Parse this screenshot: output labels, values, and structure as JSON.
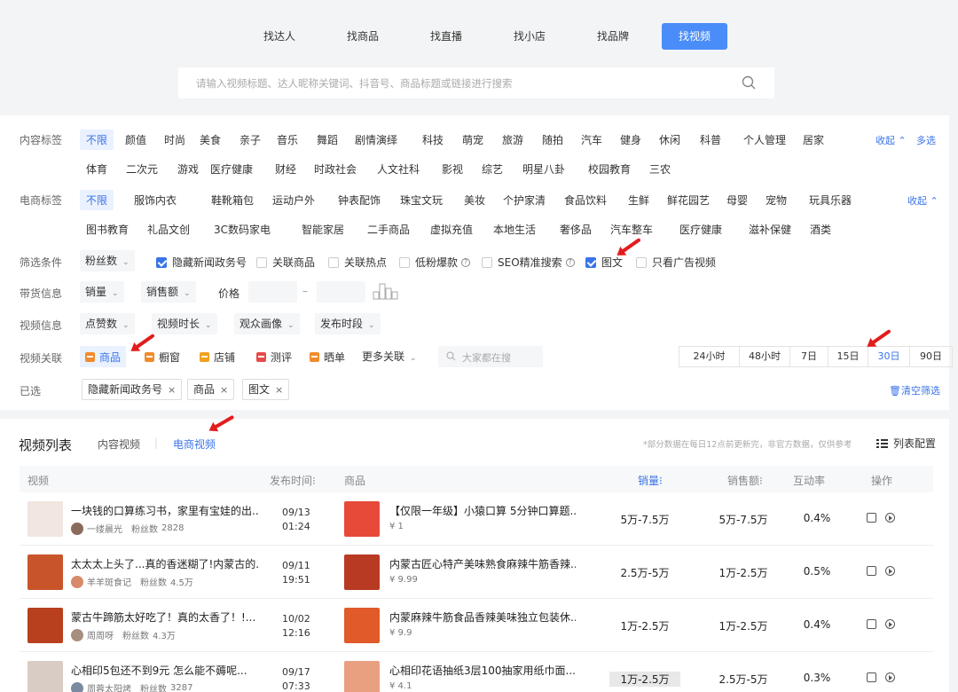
{
  "nav_tabs": [
    "找达人",
    "找商品",
    "找直播",
    "找小店",
    "找品牌",
    "找视频"
  ],
  "active_tab": "找视频",
  "search": {
    "placeholder": "请输入视频标题、达人昵称关键词、抖音号、商品标题或链接进行搜索"
  },
  "content_tags": {
    "label": "内容标签",
    "row1": [
      "不限",
      "颜值",
      "时尚",
      "美食",
      "亲子",
      "音乐",
      "舞蹈",
      "剧情演绎",
      "科技",
      "萌宠",
      "旅游",
      "随拍",
      "汽车",
      "健身",
      "休闲",
      "科普",
      "个人管理",
      "居家"
    ],
    "row2": [
      "体育",
      "二次元",
      "游戏",
      "医疗健康",
      "财经",
      "时政社会",
      "人文社科",
      "影视",
      "综艺",
      "明星八卦",
      "校园教育",
      "三农"
    ],
    "collapse": "收起",
    "multi": "多选"
  },
  "ecom_tags": {
    "label": "电商标签",
    "row1": [
      "不限",
      "服饰内衣",
      "鞋靴箱包",
      "运动户外",
      "钟表配饰",
      "珠宝文玩",
      "美妆",
      "个护家清",
      "食品饮料",
      "生鲜",
      "鲜花园艺",
      "母婴",
      "宠物",
      "玩具乐器"
    ],
    "row2": [
      "图书教育",
      "礼品文创",
      "3C数码家电",
      "智能家居",
      "二手商品",
      "虚拟充值",
      "本地生活",
      "奢侈品",
      "汽车整车",
      "医疗健康",
      "滋补保健",
      "酒类"
    ],
    "collapse": "收起"
  },
  "filter_cond": {
    "label": "筛选条件",
    "dropdown": "粉丝数",
    "options": [
      {
        "label": "隐藏新闻政务号",
        "checked": true
      },
      {
        "label": "关联商品",
        "checked": false
      },
      {
        "label": "关联热点",
        "checked": false
      },
      {
        "label": "低粉爆款",
        "checked": false
      },
      {
        "label": "SEO精准搜索",
        "checked": false
      },
      {
        "label": "图文",
        "checked": true
      },
      {
        "label": "只看广告视频",
        "checked": false
      }
    ]
  },
  "goods_info": {
    "label": "带货信息",
    "d1": "销量",
    "d2": "销售额",
    "price": "价格",
    "dash": "–"
  },
  "video_info": {
    "label": "视频信息",
    "d1": "点赞数",
    "d2": "视频时长",
    "d3": "观众画像",
    "d4": "发布时段"
  },
  "video_rel": {
    "label": "视频关联",
    "items": [
      {
        "label": "商品",
        "color": "#f08c2e"
      },
      {
        "label": "橱窗",
        "color": "#f08c2e"
      },
      {
        "label": "店铺",
        "color": "#f0a020"
      },
      {
        "label": "测评",
        "color": "#e64b4b"
      },
      {
        "label": "晒单",
        "color": "#f08c2e"
      }
    ],
    "more": "更多关联",
    "search_placeholder": "大家都在搜",
    "time_ranges": [
      "24小时",
      "48小时",
      "7日",
      "15日",
      "30日",
      "90日"
    ],
    "active_range": "30日"
  },
  "selected": {
    "label": "已选",
    "tags": [
      "隐藏新闻政务号",
      "商品",
      "图文"
    ],
    "clear": "清空筛选"
  },
  "list": {
    "title": "视频列表",
    "subtabs": [
      "内容视频",
      "电商视频"
    ],
    "active_subtab": "电商视频",
    "note": "*部分数据在每日12点前更新完，非官方数据，仅供参考",
    "col_config": "列表配置",
    "headers": [
      "视频",
      "发布时间",
      "商品",
      "销量",
      "销售额",
      "互动率",
      "操作"
    ],
    "rows": [
      {
        "title": "一块钱的口算练习书，家里有宝娃的出...",
        "author": "一缕晨光",
        "fans_label": "粉丝数",
        "fans": "2828",
        "date": "09/13",
        "time": "01:24",
        "product": "【仅限一年级】小猿口算 5分钟口算题...",
        "price": "¥ 1",
        "sales": "5万-7.5万",
        "amount": "5万-7.5万",
        "rate": "0.4%",
        "thumb": "#f1e6e0",
        "pthumb": "#e84a3a",
        "avatar": "#8a6a5a"
      },
      {
        "title": "太太太上头了...真的香迷糊了!内蒙古的...",
        "author": "羊羊斑食记",
        "fans_label": "粉丝数",
        "fans": "4.5万",
        "date": "09/11",
        "time": "19:51",
        "product": "内蒙古匠心特产美味熟食麻辣牛筋香辣...",
        "price": "¥ 9.99",
        "sales": "2.5万-5万",
        "amount": "1万-2.5万",
        "rate": "0.5%",
        "thumb": "#c8552a",
        "pthumb": "#b83a22",
        "avatar": "#d88a6a"
      },
      {
        "title": "蒙古牛蹄筋太好吃了！真的太香了！!...",
        "author": "周周呀",
        "fans_label": "粉丝数",
        "fans": "4.3万",
        "date": "10/02",
        "time": "12:16",
        "product": "内蒙麻辣牛筋食品香辣美味独立包装休...",
        "price": "¥ 9.9",
        "sales": "1万-2.5万",
        "amount": "1万-2.5万",
        "rate": "0.4%",
        "thumb": "#b8401e",
        "pthumb": "#e05a2a",
        "avatar": "#a78f80"
      },
      {
        "title": "心相印5包还不到9元 怎么能不薅呢...",
        "author": "周蓉太阳烤",
        "fans_label": "粉丝数",
        "fans": "3287",
        "date": "09/17",
        "time": "07:33",
        "product": "心相印花语抽纸3层100抽家用纸巾面...",
        "price": "¥ 4.1",
        "sales": "1万-2.5万",
        "amount": "2.5万-5万",
        "rate": "0.3%",
        "thumb": "#d8ccc4",
        "pthumb": "#e8a080",
        "avatar": "#7a8aa0",
        "highlight": true
      }
    ]
  }
}
